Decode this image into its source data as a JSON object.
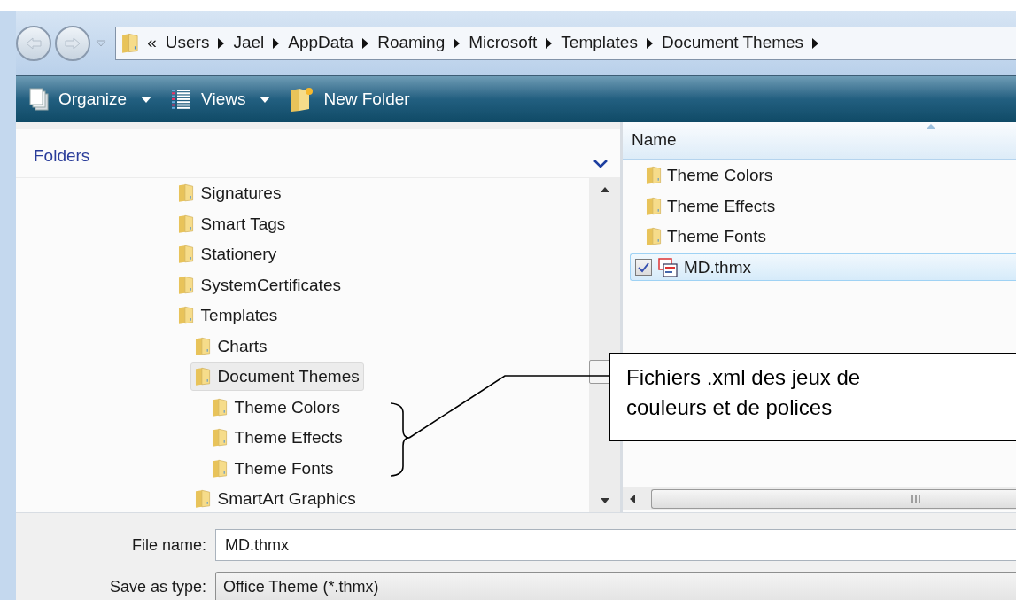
{
  "address_bar": {
    "overflow": "«",
    "crumbs": [
      "Users",
      "Jael",
      "AppData",
      "Roaming",
      "Microsoft",
      "Templates",
      "Document Themes"
    ]
  },
  "toolbar": [
    {
      "label": "Organize",
      "kind": "organize"
    },
    {
      "label": "Views",
      "kind": "views"
    },
    {
      "label": "New Folder",
      "kind": "new-folder"
    }
  ],
  "folders_pane": {
    "title": "Folders",
    "tree": [
      {
        "name": "Signatures",
        "selected": false
      },
      {
        "name": "Smart Tags",
        "selected": false
      },
      {
        "name": "Stationery",
        "selected": false
      },
      {
        "name": "SystemCertificates",
        "selected": false
      },
      {
        "name": "Templates",
        "selected": false,
        "children": [
          {
            "name": "Charts",
            "selected": false
          },
          {
            "name": "Document Themes",
            "selected": true,
            "children": [
              {
                "name": "Theme Colors",
                "selected": false
              },
              {
                "name": "Theme Effects",
                "selected": false
              },
              {
                "name": "Theme Fonts",
                "selected": false
              }
            ]
          },
          {
            "name": "SmartArt Graphics",
            "selected": false
          }
        ]
      }
    ]
  },
  "file_list": {
    "column": "Name",
    "items": [
      {
        "name": "Theme Colors",
        "kind": "folder",
        "selected": false
      },
      {
        "name": "Theme Effects",
        "kind": "folder",
        "selected": false
      },
      {
        "name": "Theme Fonts",
        "kind": "folder",
        "selected": false
      },
      {
        "name": "MD.thmx",
        "kind": "file",
        "selected": true,
        "checked": true
      }
    ]
  },
  "file_name": {
    "label": "File name:",
    "value": "MD.thmx"
  },
  "save_as_type": {
    "label": "Save as type:",
    "value": "Office Theme (*.thmx)"
  },
  "callout": "Fichiers .xml des jeux de\ncouleurs et de polices"
}
